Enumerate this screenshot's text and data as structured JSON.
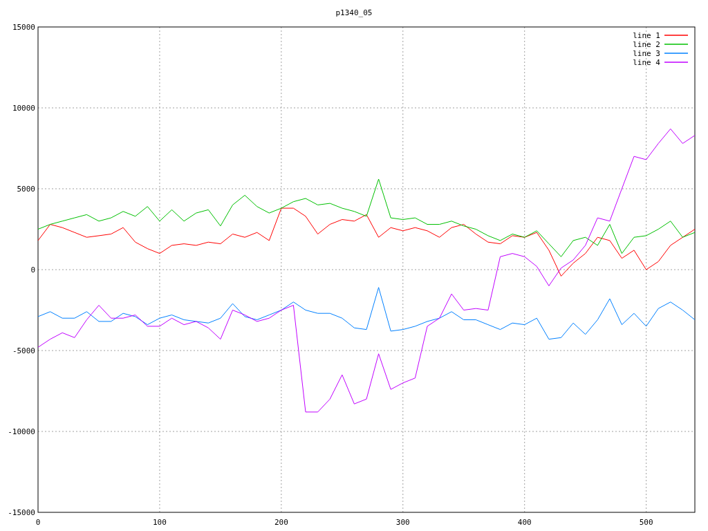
{
  "chart_data": {
    "type": "line",
    "title": "p1340_05",
    "x": [
      0,
      10,
      20,
      30,
      40,
      50,
      60,
      70,
      80,
      90,
      100,
      110,
      120,
      130,
      140,
      150,
      160,
      170,
      180,
      190,
      200,
      210,
      220,
      230,
      240,
      250,
      260,
      270,
      280,
      290,
      300,
      310,
      320,
      330,
      340,
      350,
      360,
      370,
      380,
      390,
      400,
      410,
      420,
      430,
      440,
      450,
      460,
      470,
      480,
      490,
      500,
      510,
      520,
      530,
      540
    ],
    "series": [
      {
        "name": "line 1",
        "color": "#ff0000",
        "values": [
          1800,
          2800,
          2600,
          2300,
          2000,
          2100,
          2200,
          2600,
          1700,
          1300,
          1000,
          1500,
          1600,
          1500,
          1700,
          1600,
          2200,
          2000,
          2300,
          1800,
          3800,
          3800,
          3300,
          2200,
          2800,
          3100,
          3000,
          3400,
          2000,
          2600,
          2400,
          2600,
          2400,
          2000,
          2600,
          2800,
          2200,
          1700,
          1600,
          2100,
          2000,
          2300,
          1200,
          -400,
          400,
          1000,
          2000,
          1800,
          700,
          1200,
          0,
          500,
          1500,
          2000,
          2500
        ]
      },
      {
        "name": "line 2",
        "color": "#00c000",
        "values": [
          2500,
          2800,
          3000,
          3200,
          3400,
          3000,
          3200,
          3600,
          3300,
          3900,
          3000,
          3700,
          3000,
          3500,
          3700,
          2700,
          4000,
          4600,
          3900,
          3500,
          3800,
          4200,
          4400,
          4000,
          4100,
          3800,
          3600,
          3300,
          5600,
          3200,
          3100,
          3200,
          2800,
          2800,
          3000,
          2700,
          2500,
          2100,
          1800,
          2200,
          2000,
          2400,
          1600,
          800,
          1800,
          2000,
          1500,
          2800,
          1000,
          2000,
          2100,
          2500,
          3000,
          2000,
          2300
        ]
      },
      {
        "name": "line 3",
        "color": "#0080ff",
        "values": [
          -2900,
          -2600,
          -3000,
          -3000,
          -2600,
          -3200,
          -3200,
          -2700,
          -2900,
          -3400,
          -3000,
          -2800,
          -3100,
          -3200,
          -3300,
          -3000,
          -2100,
          -2900,
          -3100,
          -2800,
          -2500,
          -2000,
          -2500,
          -2700,
          -2700,
          -3000,
          -3600,
          -3700,
          -1100,
          -3800,
          -3700,
          -3500,
          -3200,
          -3000,
          -2600,
          -3100,
          -3100,
          -3400,
          -3700,
          -3300,
          -3400,
          -3000,
          -4300,
          -4200,
          -3300,
          -4000,
          -3100,
          -1800,
          -3400,
          -2700,
          -3500,
          -2400,
          -2000,
          -2500,
          -3100
        ]
      },
      {
        "name": "line 4",
        "color": "#c000ff",
        "values": [
          -4800,
          -4300,
          -3900,
          -4200,
          -3100,
          -2200,
          -3000,
          -3000,
          -2800,
          -3500,
          -3500,
          -3000,
          -3400,
          -3200,
          -3600,
          -4300,
          -2500,
          -2800,
          -3200,
          -3000,
          -2500,
          -2200,
          -8800,
          -8800,
          -8000,
          -6500,
          -8300,
          -8000,
          -5200,
          -7400,
          -7000,
          -6700,
          -3500,
          -3000,
          -1500,
          -2500,
          -2400,
          -2500,
          800,
          1000,
          800,
          200,
          -1000,
          100,
          600,
          1500,
          3200,
          3000,
          5000,
          7000,
          6800,
          7800,
          8700,
          7800,
          8300
        ]
      }
    ],
    "xlim": [
      0,
      540
    ],
    "ylim": [
      -15000,
      15000
    ],
    "xticks": [
      0,
      100,
      200,
      300,
      400,
      500
    ],
    "yticks": [
      -15000,
      -10000,
      -5000,
      0,
      5000,
      10000,
      15000
    ],
    "grid": true,
    "legend": true
  }
}
